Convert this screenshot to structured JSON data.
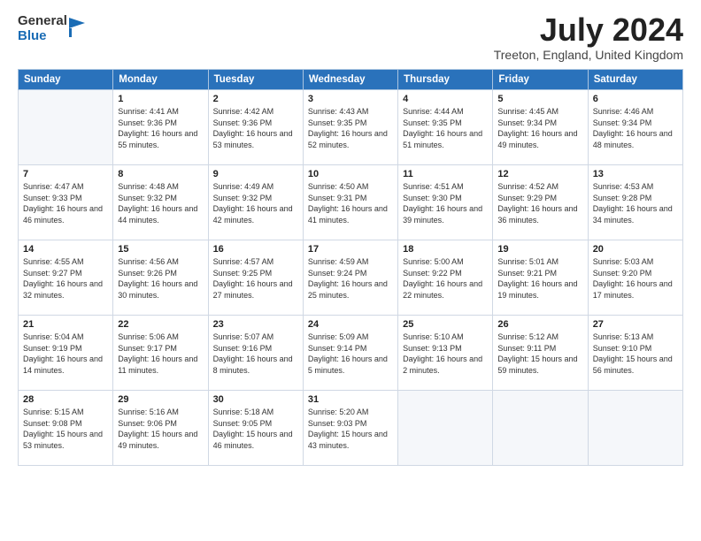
{
  "header": {
    "logo": {
      "general": "General",
      "blue": "Blue"
    },
    "title": "July 2024",
    "location": "Treeton, England, United Kingdom"
  },
  "calendar": {
    "weekdays": [
      "Sunday",
      "Monday",
      "Tuesday",
      "Wednesday",
      "Thursday",
      "Friday",
      "Saturday"
    ],
    "weeks": [
      [
        {
          "day": null,
          "info": null
        },
        {
          "day": "1",
          "info": "Sunrise: 4:41 AM\nSunset: 9:36 PM\nDaylight: 16 hours\nand 55 minutes."
        },
        {
          "day": "2",
          "info": "Sunrise: 4:42 AM\nSunset: 9:36 PM\nDaylight: 16 hours\nand 53 minutes."
        },
        {
          "day": "3",
          "info": "Sunrise: 4:43 AM\nSunset: 9:35 PM\nDaylight: 16 hours\nand 52 minutes."
        },
        {
          "day": "4",
          "info": "Sunrise: 4:44 AM\nSunset: 9:35 PM\nDaylight: 16 hours\nand 51 minutes."
        },
        {
          "day": "5",
          "info": "Sunrise: 4:45 AM\nSunset: 9:34 PM\nDaylight: 16 hours\nand 49 minutes."
        },
        {
          "day": "6",
          "info": "Sunrise: 4:46 AM\nSunset: 9:34 PM\nDaylight: 16 hours\nand 48 minutes."
        }
      ],
      [
        {
          "day": "7",
          "info": "Sunrise: 4:47 AM\nSunset: 9:33 PM\nDaylight: 16 hours\nand 46 minutes."
        },
        {
          "day": "8",
          "info": "Sunrise: 4:48 AM\nSunset: 9:32 PM\nDaylight: 16 hours\nand 44 minutes."
        },
        {
          "day": "9",
          "info": "Sunrise: 4:49 AM\nSunset: 9:32 PM\nDaylight: 16 hours\nand 42 minutes."
        },
        {
          "day": "10",
          "info": "Sunrise: 4:50 AM\nSunset: 9:31 PM\nDaylight: 16 hours\nand 41 minutes."
        },
        {
          "day": "11",
          "info": "Sunrise: 4:51 AM\nSunset: 9:30 PM\nDaylight: 16 hours\nand 39 minutes."
        },
        {
          "day": "12",
          "info": "Sunrise: 4:52 AM\nSunset: 9:29 PM\nDaylight: 16 hours\nand 36 minutes."
        },
        {
          "day": "13",
          "info": "Sunrise: 4:53 AM\nSunset: 9:28 PM\nDaylight: 16 hours\nand 34 minutes."
        }
      ],
      [
        {
          "day": "14",
          "info": "Sunrise: 4:55 AM\nSunset: 9:27 PM\nDaylight: 16 hours\nand 32 minutes."
        },
        {
          "day": "15",
          "info": "Sunrise: 4:56 AM\nSunset: 9:26 PM\nDaylight: 16 hours\nand 30 minutes."
        },
        {
          "day": "16",
          "info": "Sunrise: 4:57 AM\nSunset: 9:25 PM\nDaylight: 16 hours\nand 27 minutes."
        },
        {
          "day": "17",
          "info": "Sunrise: 4:59 AM\nSunset: 9:24 PM\nDaylight: 16 hours\nand 25 minutes."
        },
        {
          "day": "18",
          "info": "Sunrise: 5:00 AM\nSunset: 9:22 PM\nDaylight: 16 hours\nand 22 minutes."
        },
        {
          "day": "19",
          "info": "Sunrise: 5:01 AM\nSunset: 9:21 PM\nDaylight: 16 hours\nand 19 minutes."
        },
        {
          "day": "20",
          "info": "Sunrise: 5:03 AM\nSunset: 9:20 PM\nDaylight: 16 hours\nand 17 minutes."
        }
      ],
      [
        {
          "day": "21",
          "info": "Sunrise: 5:04 AM\nSunset: 9:19 PM\nDaylight: 16 hours\nand 14 minutes."
        },
        {
          "day": "22",
          "info": "Sunrise: 5:06 AM\nSunset: 9:17 PM\nDaylight: 16 hours\nand 11 minutes."
        },
        {
          "day": "23",
          "info": "Sunrise: 5:07 AM\nSunset: 9:16 PM\nDaylight: 16 hours\nand 8 minutes."
        },
        {
          "day": "24",
          "info": "Sunrise: 5:09 AM\nSunset: 9:14 PM\nDaylight: 16 hours\nand 5 minutes."
        },
        {
          "day": "25",
          "info": "Sunrise: 5:10 AM\nSunset: 9:13 PM\nDaylight: 16 hours\nand 2 minutes."
        },
        {
          "day": "26",
          "info": "Sunrise: 5:12 AM\nSunset: 9:11 PM\nDaylight: 15 hours\nand 59 minutes."
        },
        {
          "day": "27",
          "info": "Sunrise: 5:13 AM\nSunset: 9:10 PM\nDaylight: 15 hours\nand 56 minutes."
        }
      ],
      [
        {
          "day": "28",
          "info": "Sunrise: 5:15 AM\nSunset: 9:08 PM\nDaylight: 15 hours\nand 53 minutes."
        },
        {
          "day": "29",
          "info": "Sunrise: 5:16 AM\nSunset: 9:06 PM\nDaylight: 15 hours\nand 49 minutes."
        },
        {
          "day": "30",
          "info": "Sunrise: 5:18 AM\nSunset: 9:05 PM\nDaylight: 15 hours\nand 46 minutes."
        },
        {
          "day": "31",
          "info": "Sunrise: 5:20 AM\nSunset: 9:03 PM\nDaylight: 15 hours\nand 43 minutes."
        },
        {
          "day": null,
          "info": null
        },
        {
          "day": null,
          "info": null
        },
        {
          "day": null,
          "info": null
        }
      ]
    ]
  }
}
